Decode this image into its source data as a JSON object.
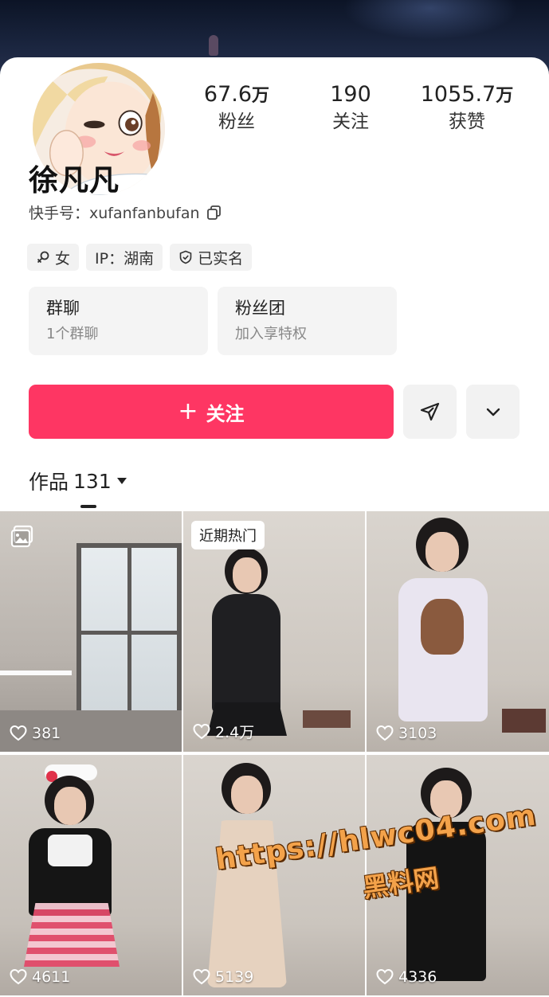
{
  "profile": {
    "name": "徐凡凡",
    "kuaishou_id_label": "快手号：",
    "kuaishou_id": "xufanfanbufan",
    "stats": [
      {
        "value": "67.6",
        "unit": "万",
        "label": "粉丝"
      },
      {
        "value": "190",
        "unit": "",
        "label": "关注"
      },
      {
        "value": "1055.7",
        "unit": "万",
        "label": "获赞"
      }
    ],
    "tags": [
      {
        "icon": "female-icon",
        "text": "女"
      },
      {
        "icon": "",
        "text": "IP：湖南"
      },
      {
        "icon": "verified-shield-icon",
        "text": "已实名"
      }
    ]
  },
  "cards": [
    {
      "title": "群聊",
      "subtitle": "1个群聊"
    },
    {
      "title": "粉丝团",
      "subtitle": "加入享特权"
    }
  ],
  "actions": {
    "follow_label": "关注",
    "follow_plus": "+",
    "share_icon": "send-icon",
    "more_icon": "chevron-down-icon"
  },
  "works": {
    "label": "作品",
    "count": "131"
  },
  "grid": [
    {
      "likes": "381",
      "badge": "",
      "album": true
    },
    {
      "likes": "2.4万",
      "badge": "近期热门",
      "album": false
    },
    {
      "likes": "3103",
      "badge": "",
      "album": false
    },
    {
      "likes": "4611",
      "badge": "",
      "album": false
    },
    {
      "likes": "5139",
      "badge": "",
      "album": false
    },
    {
      "likes": "4336",
      "badge": "",
      "album": false
    }
  ],
  "watermark": {
    "url": "https://hlwc04.com",
    "site": "黑料网"
  },
  "colors": {
    "accent": "#fe3663",
    "watermark": "#f3a24a"
  }
}
